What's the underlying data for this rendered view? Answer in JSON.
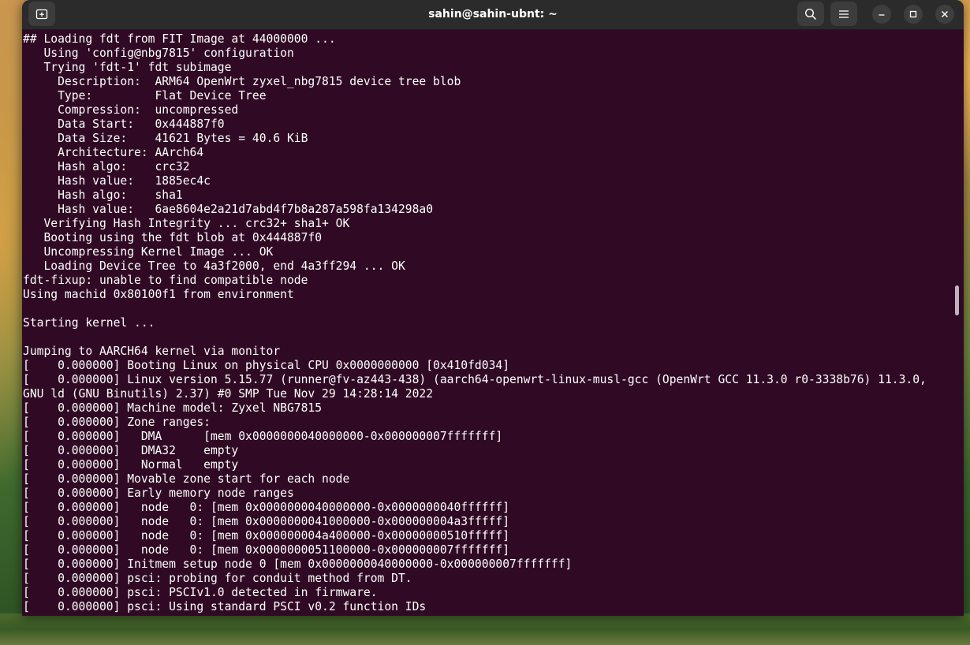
{
  "window": {
    "title": "sahin@sahin-ubnt: ~",
    "background": "#300a24",
    "titlebar_color": "#2b2b2b"
  },
  "titlebar": {
    "new_tab_icon": "new-tab-icon",
    "search_icon": "search-icon",
    "menu_icon": "hamburger-menu-icon",
    "minimize_icon": "minimize-icon",
    "maximize_icon": "maximize-icon",
    "close_icon": "close-icon"
  },
  "terminal": {
    "lines": [
      "## Loading fdt from FIT Image at 44000000 ...",
      "   Using 'config@nbg7815' configuration",
      "   Trying 'fdt-1' fdt subimage",
      "     Description:  ARM64 OpenWrt zyxel_nbg7815 device tree blob",
      "     Type:         Flat Device Tree",
      "     Compression:  uncompressed",
      "     Data Start:   0x444887f0",
      "     Data Size:    41621 Bytes = 40.6 KiB",
      "     Architecture: AArch64",
      "     Hash algo:    crc32",
      "     Hash value:   1885ec4c",
      "     Hash algo:    sha1",
      "     Hash value:   6ae8604e2a21d7abd4f7b8a287a598fa134298a0",
      "   Verifying Hash Integrity ... crc32+ sha1+ OK",
      "   Booting using the fdt blob at 0x444887f0",
      "   Uncompressing Kernel Image ... OK",
      "   Loading Device Tree to 4a3f2000, end 4a3ff294 ... OK",
      "fdt-fixup: unable to find compatible node",
      "Using machid 0x80100f1 from environment",
      "",
      "Starting kernel ...",
      "",
      "Jumping to AARCH64 kernel via monitor",
      "[    0.000000] Booting Linux on physical CPU 0x0000000000 [0x410fd034]",
      "[    0.000000] Linux version 5.15.77 (runner@fv-az443-438) (aarch64-openwrt-linux-musl-gcc (OpenWrt GCC 11.3.0 r0-3338b76) 11.3.0,",
      "GNU ld (GNU Binutils) 2.37) #0 SMP Tue Nov 29 14:28:14 2022",
      "[    0.000000] Machine model: Zyxel NBG7815",
      "[    0.000000] Zone ranges:",
      "[    0.000000]   DMA      [mem 0x0000000040000000-0x000000007fffffff]",
      "[    0.000000]   DMA32    empty",
      "[    0.000000]   Normal   empty",
      "[    0.000000] Movable zone start for each node",
      "[    0.000000] Early memory node ranges",
      "[    0.000000]   node   0: [mem 0x0000000040000000-0x0000000040ffffff]",
      "[    0.000000]   node   0: [mem 0x0000000041000000-0x000000004a3fffff]",
      "[    0.000000]   node   0: [mem 0x000000004a400000-0x00000000510fffff]",
      "[    0.000000]   node   0: [mem 0x0000000051100000-0x000000007fffffff]",
      "[    0.000000] Initmem setup node 0 [mem 0x0000000040000000-0x000000007fffffff]",
      "[    0.000000] psci: probing for conduit method from DT.",
      "[    0.000000] psci: PSCIv1.0 detected in firmware.",
      "[    0.000000] psci: Using standard PSCI v0.2 function IDs"
    ]
  }
}
